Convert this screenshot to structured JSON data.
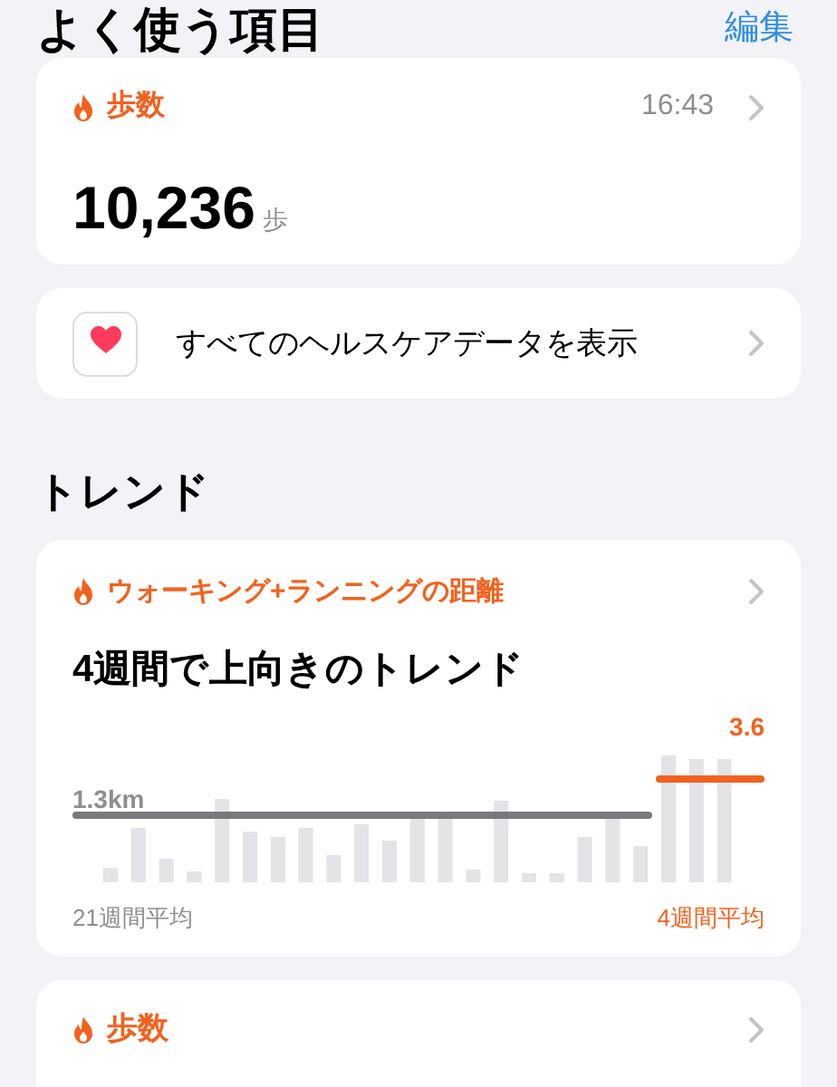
{
  "favorites": {
    "title": "よく使う項目",
    "edit": "編集"
  },
  "steps_card": {
    "title": "歩数",
    "time": "16:43",
    "value": "10,236",
    "unit": "歩"
  },
  "all_data": {
    "label": "すべてのヘルスケアデータを表示"
  },
  "trends": {
    "title": "トレンド"
  },
  "trend_card": {
    "title": "ウォーキング+ランニングの距離",
    "headline": "4週間で上向きのトレンド",
    "long_value": "1.3km",
    "short_value": "3.6",
    "long_label": "21週間平均",
    "short_label": "4週間平均"
  },
  "next_card": {
    "title": "歩数"
  }
}
